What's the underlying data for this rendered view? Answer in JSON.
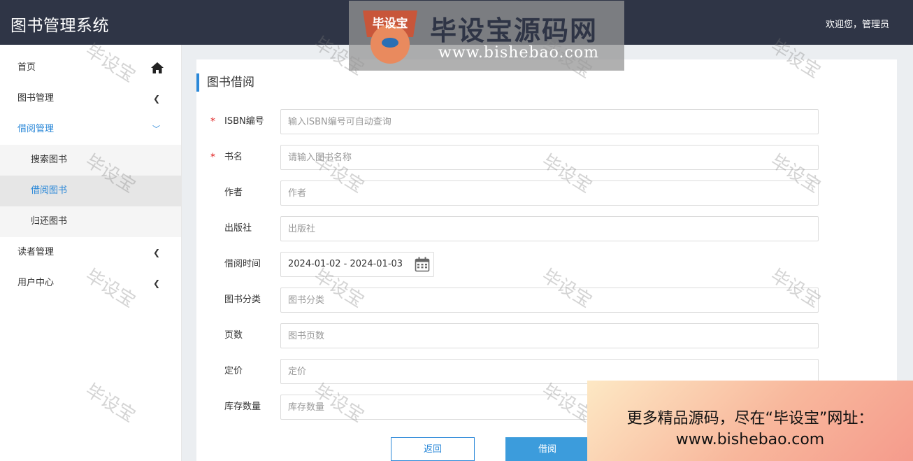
{
  "header": {
    "app_title": "图书管理系统",
    "welcome": "欢迎您，管理员"
  },
  "sidebar": {
    "home": {
      "label": "首页",
      "icon": "home-icon"
    },
    "book_manage": {
      "label": "图书管理",
      "icon": "chevron-left-icon"
    },
    "borrow_manage": {
      "label": "借阅管理",
      "icon": "chevron-down-icon",
      "children": [
        {
          "label": "搜索图书"
        },
        {
          "label": "借阅图书",
          "active": true
        },
        {
          "label": "归还图书"
        }
      ]
    },
    "reader_manage": {
      "label": "读者管理",
      "icon": "chevron-left-icon"
    },
    "user_center": {
      "label": "用户中心",
      "icon": "chevron-left-icon"
    }
  },
  "form": {
    "title": "图书借阅",
    "fields": {
      "isbn": {
        "label": "ISBN编号",
        "placeholder": "输入ISBN编号可自动查询",
        "required": true
      },
      "name": {
        "label": "书名",
        "placeholder": "请输入图书名称",
        "required": true
      },
      "author": {
        "label": "作者",
        "placeholder": "作者"
      },
      "publisher": {
        "label": "出版社",
        "placeholder": "出版社"
      },
      "borrow_time": {
        "label": "借阅时间",
        "value": "2024-01-02 - 2024-01-03",
        "icon": "calendar-icon"
      },
      "category": {
        "label": "图书分类",
        "placeholder": "图书分类"
      },
      "pages": {
        "label": "页数",
        "placeholder": "图书页数"
      },
      "price": {
        "label": "定价",
        "placeholder": "定价"
      },
      "stock": {
        "label": "库存数量",
        "placeholder": "库存数量"
      }
    },
    "required_mark": "*",
    "buttons": {
      "back": "返回",
      "borrow": "借阅"
    }
  },
  "watermark": {
    "brand": "毕设宝源码网",
    "url": "www.bishebao.com",
    "badge": "毕设宝",
    "tile_text": "毕设宝",
    "promo_line1": "更多精品源码，尽在“毕设宝”网址：",
    "promo_line2": "www.bishebao.com"
  },
  "colors": {
    "topbar": "#2f3546",
    "accent": "#2b88d8",
    "required": "#e02020",
    "button_primary": "#3c9cdc"
  }
}
